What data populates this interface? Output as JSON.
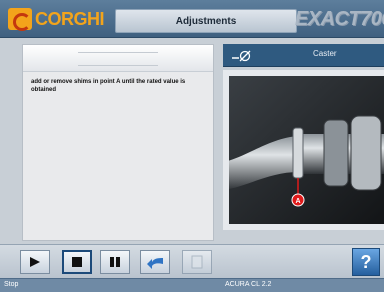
{
  "header": {
    "logo_text": "CORGHI",
    "title": "Adjustments",
    "brand": "EXACT",
    "brand_model": "700"
  },
  "left_panel": {
    "instruction": "add or remove shims in point A until the rated value is obtained"
  },
  "right_panel": {
    "header_label": "Caster",
    "icon": "caster-angle-icon",
    "point_label": "A"
  },
  "toolbar": {
    "buttons": [
      "play-icon",
      "stop-icon",
      "pause-icon",
      "back-arrow-icon",
      "blank-button"
    ],
    "help_label": "?"
  },
  "status": {
    "state": "Stop",
    "vehicle": "ACURA CL 2.2"
  },
  "colors": {
    "accent": "#3f6080",
    "logo": "#f3a41b",
    "marker": "#e01b1b"
  }
}
